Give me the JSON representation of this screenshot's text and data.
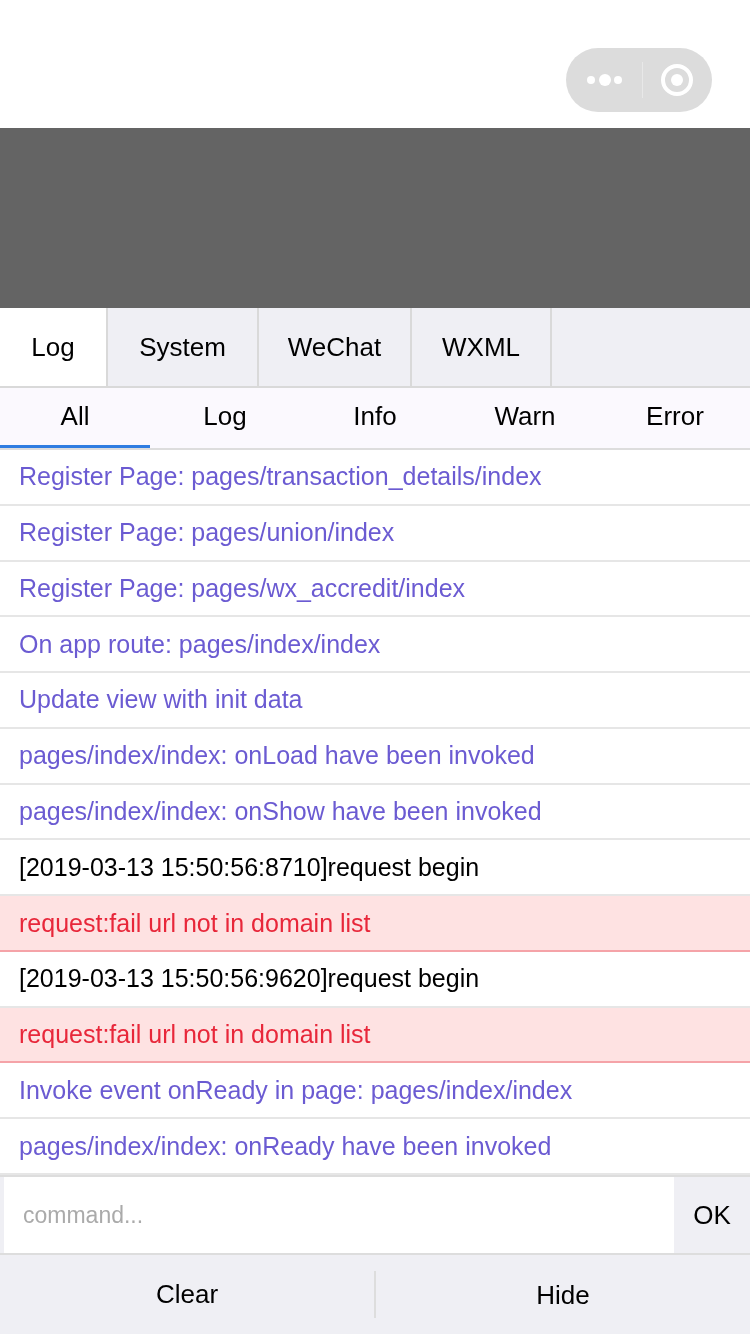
{
  "tabs": [
    {
      "label": "Log",
      "selected": true
    },
    {
      "label": "System",
      "selected": false
    },
    {
      "label": "WeChat",
      "selected": false
    },
    {
      "label": "WXML",
      "selected": false
    }
  ],
  "filters": [
    {
      "label": "All",
      "selected": true
    },
    {
      "label": "Log",
      "selected": false
    },
    {
      "label": "Info",
      "selected": false
    },
    {
      "label": "Warn",
      "selected": false
    },
    {
      "label": "Error",
      "selected": false
    }
  ],
  "logs": [
    {
      "kind": "info",
      "text": "Register Page: pages/transaction_details/index"
    },
    {
      "kind": "info",
      "text": "Register Page: pages/union/index"
    },
    {
      "kind": "info",
      "text": "Register Page: pages/wx_accredit/index"
    },
    {
      "kind": "info",
      "text": "On app route: pages/index/index"
    },
    {
      "kind": "info",
      "text": "Update view with init data"
    },
    {
      "kind": "info",
      "text": "pages/index/index: onLoad have been invoked"
    },
    {
      "kind": "info",
      "text": "pages/index/index: onShow have been invoked"
    },
    {
      "kind": "log",
      "text": "[2019-03-13 15:50:56:8710]request begin"
    },
    {
      "kind": "error",
      "text": "request:fail url not in domain list"
    },
    {
      "kind": "log",
      "text": "[2019-03-13 15:50:56:9620]request begin"
    },
    {
      "kind": "error",
      "text": "request:fail url not in domain list"
    },
    {
      "kind": "info",
      "text": "Invoke event onReady in page: pages/index/index"
    },
    {
      "kind": "info",
      "text": "pages/index/index: onReady have been invoked"
    }
  ],
  "command": {
    "placeholder": "command...",
    "button": "OK"
  },
  "footer": [
    "Clear",
    "Hide"
  ]
}
